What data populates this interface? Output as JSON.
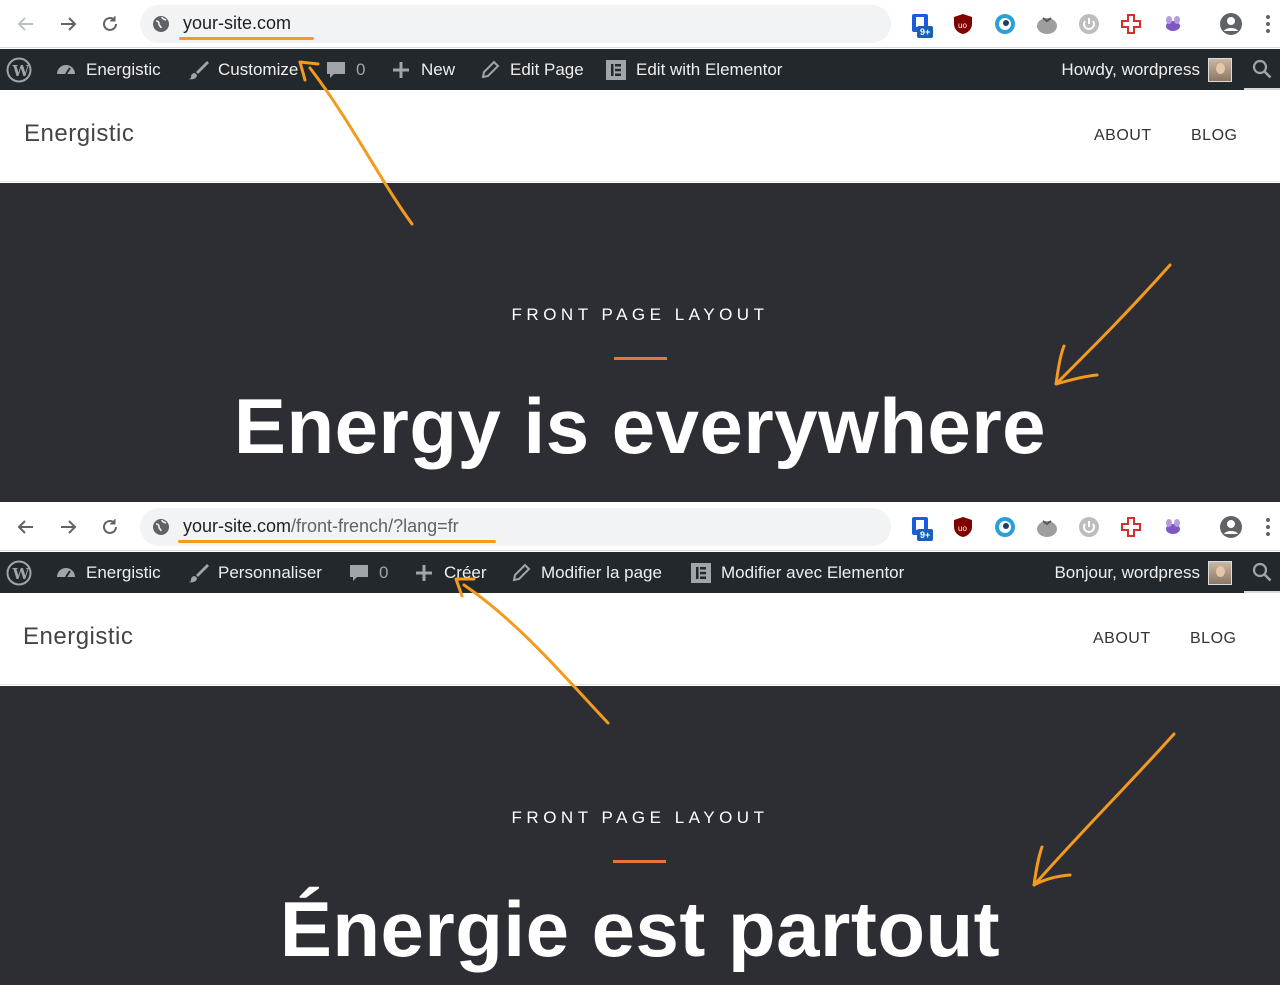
{
  "panels": [
    {
      "url_host": "your-site.com",
      "url_path": "",
      "extensions": {
        "badge": "9+"
      },
      "adminbar": {
        "site": "Energistic",
        "customize": "Customize",
        "comments": "0",
        "new": "New",
        "edit_page": "Edit Page",
        "elementor": "Edit with Elementor",
        "howdy": "Howdy, wordpress"
      },
      "site": {
        "name": "Energistic",
        "nav": [
          "ABOUT",
          "BLOG"
        ]
      },
      "hero": {
        "eyebrow": "FRONT PAGE LAYOUT",
        "headline": "Energy is everywhere"
      }
    },
    {
      "url_host": "your-site.com",
      "url_path": "/front-french/?lang=fr",
      "extensions": {
        "badge": "9+"
      },
      "adminbar": {
        "site": "Energistic",
        "customize": "Personnaliser",
        "comments": "0",
        "new": "Créer",
        "edit_page": "Modifier la page",
        "elementor": "Modifier avec Elementor",
        "howdy": "Bonjour, wordpress"
      },
      "site": {
        "name": "Energistic",
        "nav": [
          "ABOUT",
          "BLOG"
        ]
      },
      "hero": {
        "eyebrow": "FRONT PAGE LAYOUT",
        "headline": "Énergie est partout"
      }
    }
  ],
  "colors": {
    "annotation": "#f39a1f",
    "adminbar": "#23282d",
    "hero_bg": "#2d2e33",
    "accent_rule": "#e8743b"
  },
  "icons": [
    "back-arrow-icon",
    "forward-arrow-icon",
    "reload-icon",
    "globe-icon",
    "bitwarden-icon",
    "ublock-icon",
    "eye-icon",
    "tomato-icon",
    "power-icon",
    "plus-cross-icon",
    "bee-icon",
    "profile-icon",
    "kebab-menu-icon",
    "wordpress-logo-icon",
    "dashboard-icon",
    "brush-icon",
    "comment-icon",
    "plus-icon",
    "pencil-icon",
    "elementor-icon",
    "search-icon"
  ]
}
